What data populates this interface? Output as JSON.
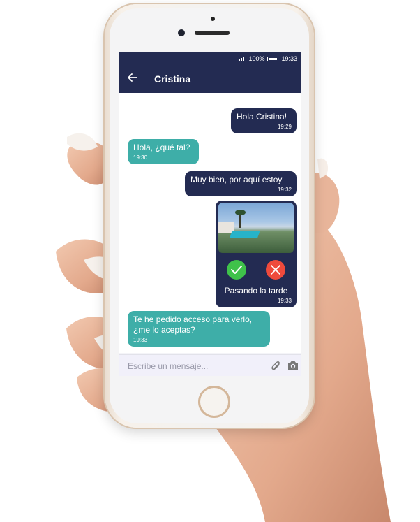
{
  "status_bar": {
    "battery_percent": "100%",
    "time": "19:33"
  },
  "app_bar": {
    "back_icon": "arrow-left-icon",
    "contact_name": "Cristina"
  },
  "messages": [
    {
      "direction": "outgoing",
      "text": "Hola Cristina!",
      "time": "19:29"
    },
    {
      "direction": "incoming",
      "text": "Hola, ¿qué tal?",
      "time": "19:30"
    },
    {
      "direction": "outgoing",
      "text": "Muy bien, por aquí estoy",
      "time": "19:32"
    },
    {
      "direction": "outgoing",
      "type": "image",
      "caption": "Pasando la tarde",
      "time": "19:33",
      "accept_icon": "check-icon",
      "reject_icon": "close-icon"
    },
    {
      "direction": "incoming",
      "text": "Te he pedido acceso para verlo, ¿me lo aceptas?",
      "time": "19:33"
    }
  ],
  "input_bar": {
    "placeholder": "Escribe un mensaje...",
    "attach_icon": "paperclip-icon",
    "camera_icon": "camera-icon"
  },
  "colors": {
    "header": "#232b52",
    "outgoing_bubble": "#232b52",
    "incoming_bubble": "#3eaea8",
    "accept": "#3fc24a",
    "reject": "#ef4a3c"
  }
}
